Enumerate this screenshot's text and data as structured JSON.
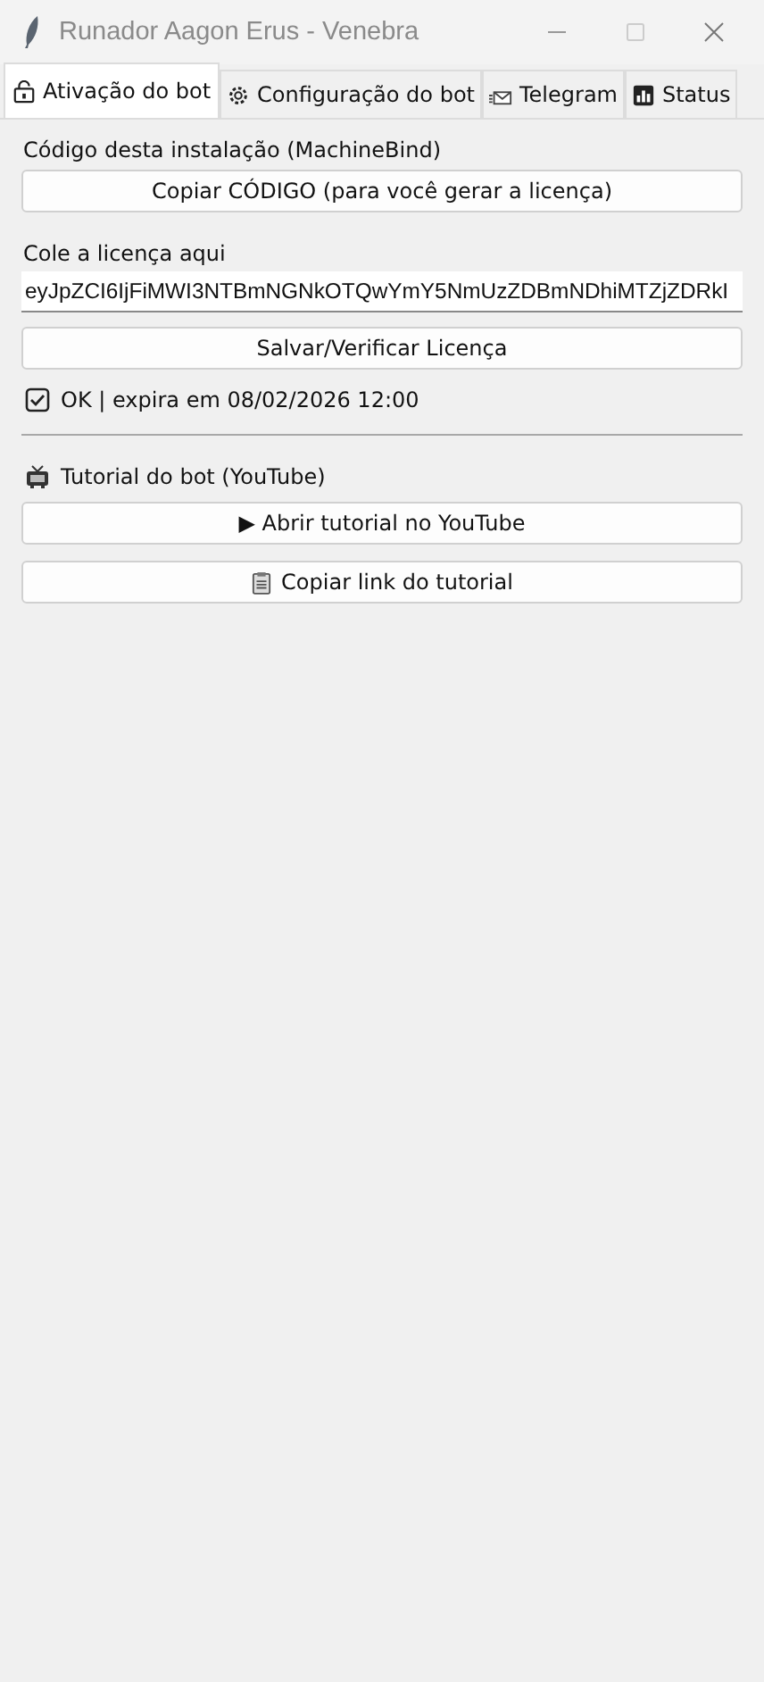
{
  "window": {
    "title": "Runador Aagon Erus - Venebra"
  },
  "tabs": [
    {
      "label": "Ativação do bot",
      "selected": true
    },
    {
      "label": "Configuração do bot",
      "selected": false
    },
    {
      "label": "Telegram",
      "selected": false
    },
    {
      "label": "Status",
      "selected": false
    }
  ],
  "activation": {
    "code_label": "Código desta instalação (MachineBind)",
    "copy_button": "Copiar CÓDIGO (para você gerar a licença)",
    "license_label": "Cole a licença aqui",
    "license_value": "eyJpZCI6IjFiMWI3NTBmNGNkOTQwYmY5NmUzZDBmNDhiMTZjZDRkI",
    "save_button": "Salvar/Verificar Licença",
    "status": "OK | expira em 08/02/2026 12:00"
  },
  "tutorial": {
    "title": "Tutorial do bot (YouTube)",
    "open_button": "▶ Abrir tutorial no YouTube",
    "copy_button": "Copiar link do tutorial"
  }
}
